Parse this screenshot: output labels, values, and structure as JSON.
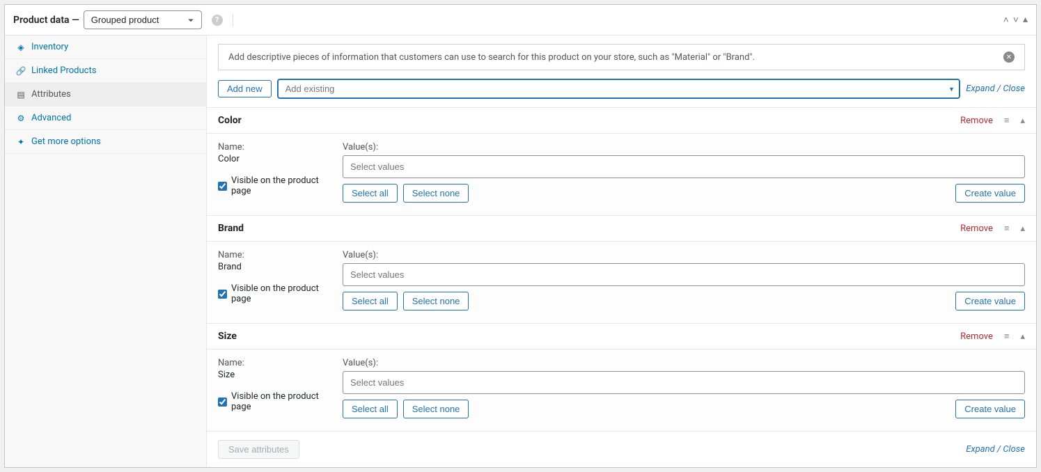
{
  "header": {
    "title": "Product data —",
    "product_type": "Grouped product"
  },
  "tabs": [
    {
      "id": "inventory",
      "icon": "◈",
      "label": "Inventory"
    },
    {
      "id": "linked",
      "icon": "🔗",
      "label": "Linked Products"
    },
    {
      "id": "attributes",
      "icon": "▤",
      "label": "Attributes"
    },
    {
      "id": "advanced",
      "icon": "⚙",
      "label": "Advanced"
    },
    {
      "id": "more",
      "icon": "✦",
      "label": "Get more options"
    }
  ],
  "active_tab": "attributes",
  "info_text": "Add descriptive pieces of information that customers can use to search for this product on your store, such as \"Material\" or \"Brand\".",
  "toolbar": {
    "add_new": "Add new",
    "add_existing_placeholder": "Add existing",
    "expand_collapse": "Expand / Close"
  },
  "attr_labels": {
    "name": "Name:",
    "values": "Value(s):",
    "visible": "Visible on the product page",
    "select_placeholder": "Select values",
    "select_all": "Select all",
    "select_none": "Select none",
    "create_value": "Create value",
    "remove": "Remove"
  },
  "attributes": [
    {
      "title": "Color",
      "name": "Color",
      "visible": true
    },
    {
      "title": "Brand",
      "name": "Brand",
      "visible": true
    },
    {
      "title": "Size",
      "name": "Size",
      "visible": true
    }
  ],
  "save": {
    "save_attributes": "Save attributes",
    "expand_collapse": "Expand / Close"
  }
}
